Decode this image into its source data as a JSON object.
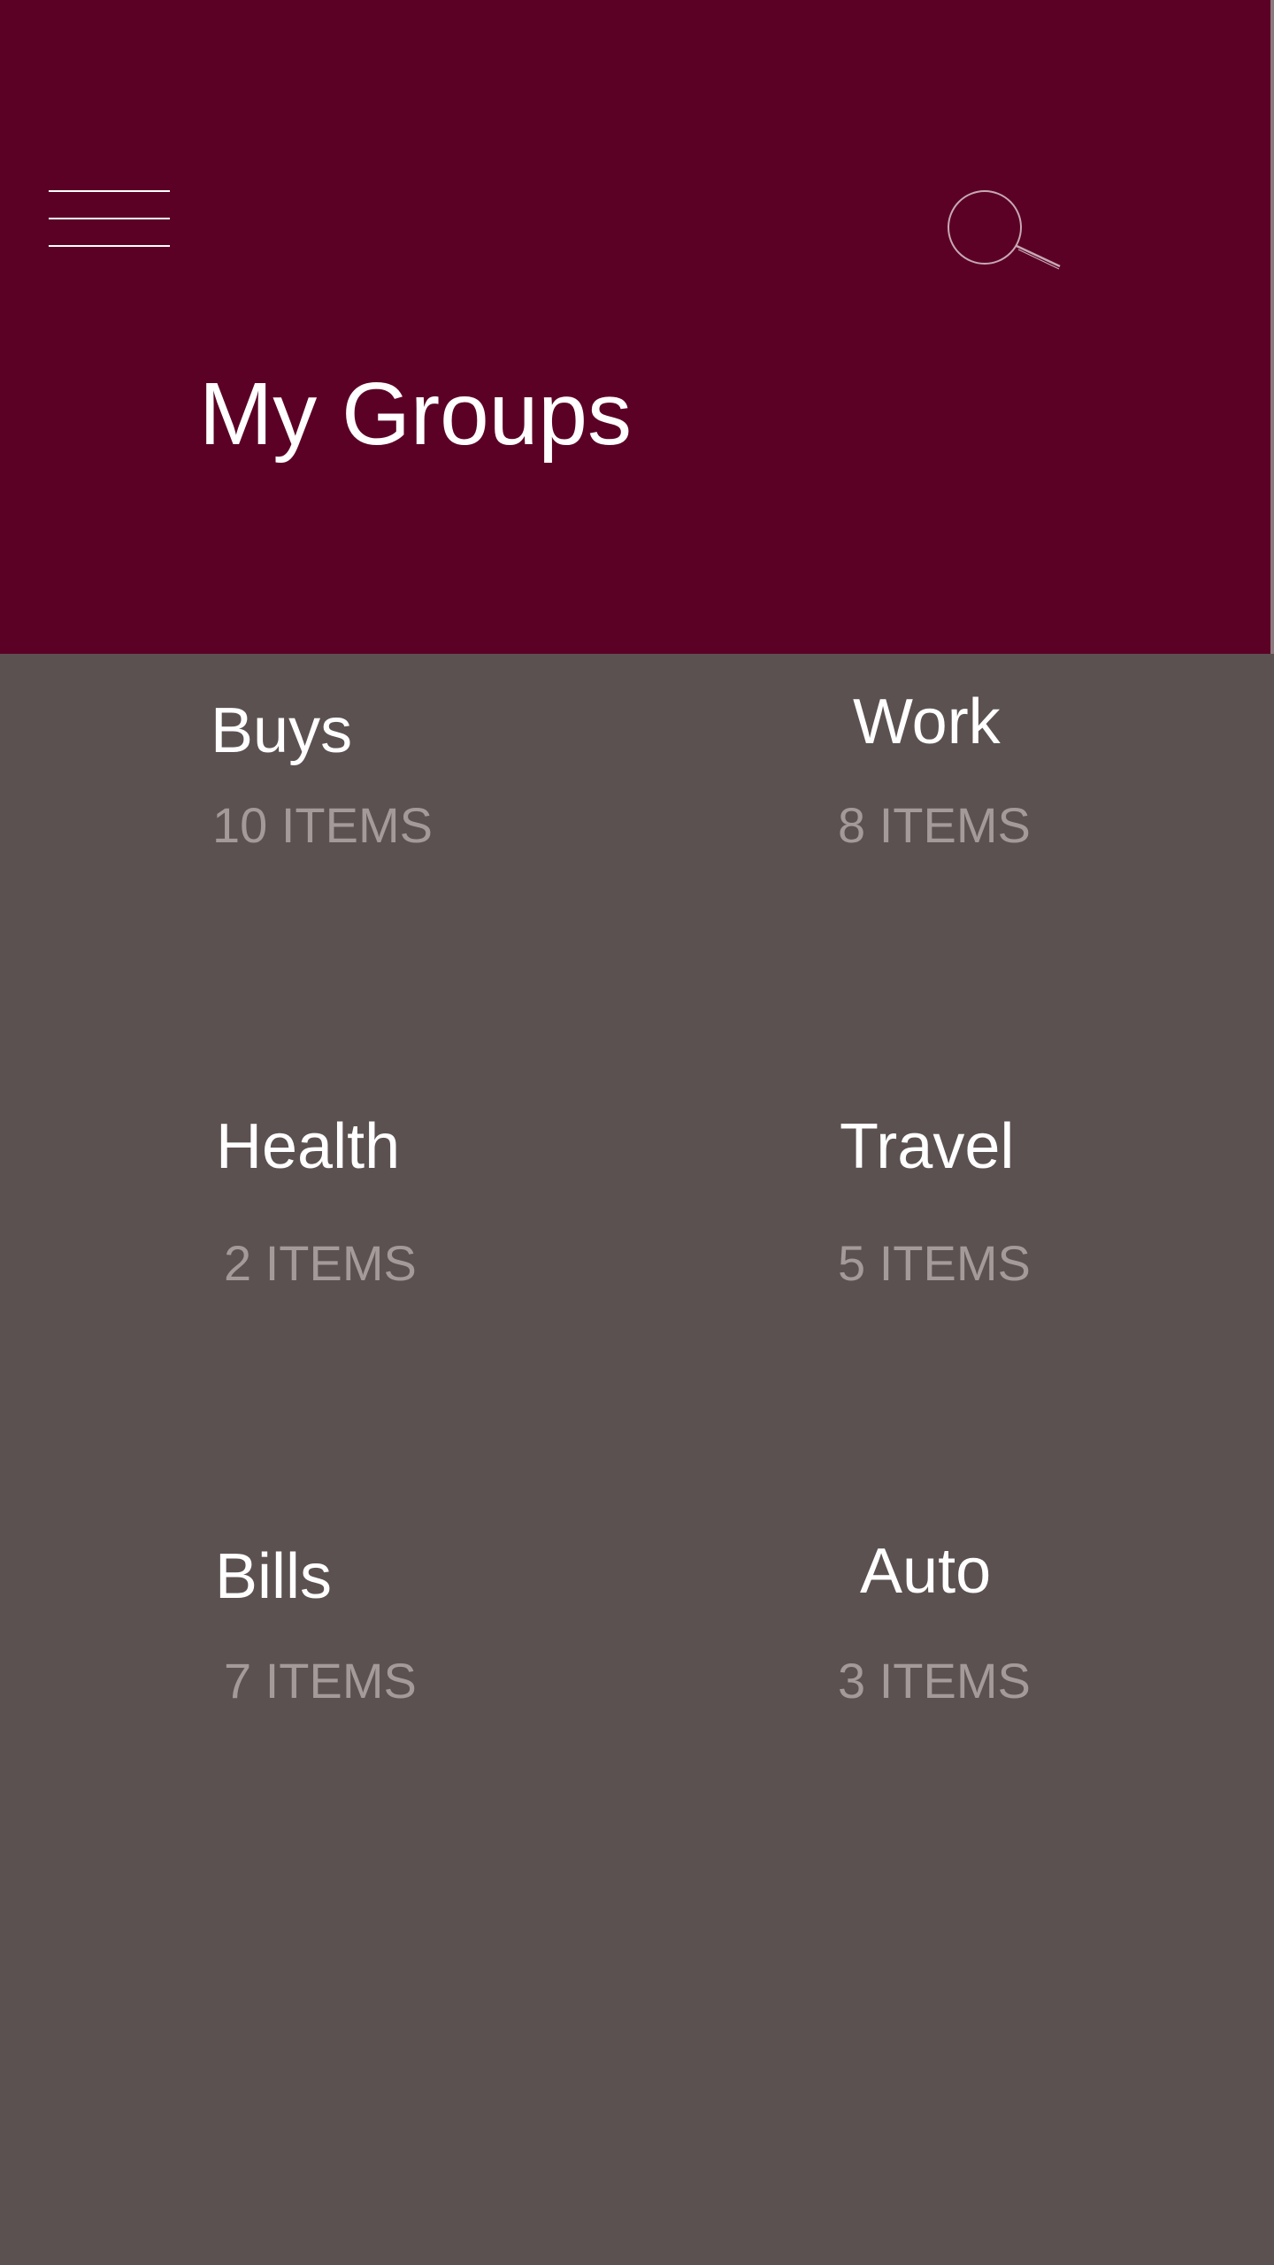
{
  "colors": {
    "header_background": "#5c0126",
    "body_background": "#5c5151",
    "title_text": "#ffffff",
    "count_text": "#a49a9a"
  },
  "header": {
    "menu_icon": "hamburger-menu-icon",
    "search_icon": "search-icon",
    "title": "My Groups"
  },
  "groups": [
    {
      "name": "Buys",
      "count": "10 ITEMS"
    },
    {
      "name": "Work",
      "count": "8 ITEMS"
    },
    {
      "name": "Health",
      "count": "2 ITEMS"
    },
    {
      "name": "Travel",
      "count": "5 ITEMS"
    },
    {
      "name": "Bills",
      "count": "7 ITEMS"
    },
    {
      "name": "Auto",
      "count": "3 ITEMS"
    }
  ]
}
